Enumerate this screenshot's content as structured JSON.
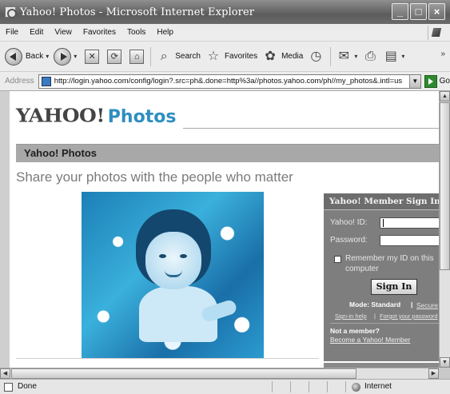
{
  "window": {
    "title": "Yahoo! Photos - Microsoft Internet Explorer",
    "minimize_glyph": "_",
    "maximize_glyph": "□",
    "close_glyph": "×"
  },
  "menu": {
    "items": [
      "File",
      "Edit",
      "View",
      "Favorites",
      "Tools",
      "Help"
    ]
  },
  "toolbar": {
    "back_label": "Back",
    "search_label": "Search",
    "favorites_label": "Favorites",
    "media_label": "Media",
    "overflow_glyph": "»"
  },
  "address": {
    "label": "Address",
    "url": "http://login.yahoo.com/config/login?.src=ph&.done=http%3a//photos.yahoo.com/ph//my_photos&.intl=us",
    "go_label": "Go"
  },
  "page": {
    "logo_text": "YAHOO!",
    "logo_product": "Photos",
    "section_header": "Yahoo! Photos",
    "tagline": "Share your photos with the people who matter"
  },
  "signin": {
    "title": "Yahoo! Member Sign In",
    "yahoo_id_label": "Yahoo! ID:",
    "password_label": "Password:",
    "remember_label_line1": "Remember my ID on this",
    "remember_label_line2": "computer",
    "button_label": "Sign In",
    "mode_label": "Mode: Standard",
    "mode_separator": "|",
    "secure_link": "Secure",
    "help_link": "Sign-in help",
    "link_separator": "|",
    "forgot_link": "Forgot your password",
    "not_member": "Not a member?",
    "register_link": "Become a Yahoo! Member"
  },
  "status": {
    "text": "Done",
    "zone": "Internet"
  }
}
